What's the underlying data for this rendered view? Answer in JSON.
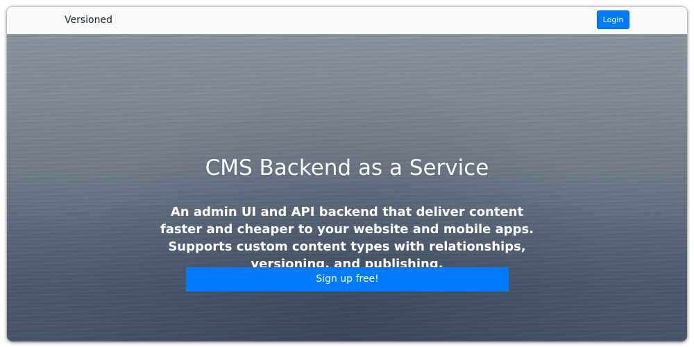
{
  "navbar": {
    "brand": "Versioned",
    "login_label": "Login"
  },
  "hero": {
    "title": "CMS Backend as a Service",
    "subtitle": "An admin UI and API backend that deliver content faster and cheaper to your website and mobile apps. Supports custom content types with relationships, versioning, and publishing.",
    "signup_label": "Sign up free!"
  },
  "colors": {
    "primary": "#007bff",
    "navbar_bg": "#f8f9fa",
    "hero_text": "#ffffff"
  }
}
